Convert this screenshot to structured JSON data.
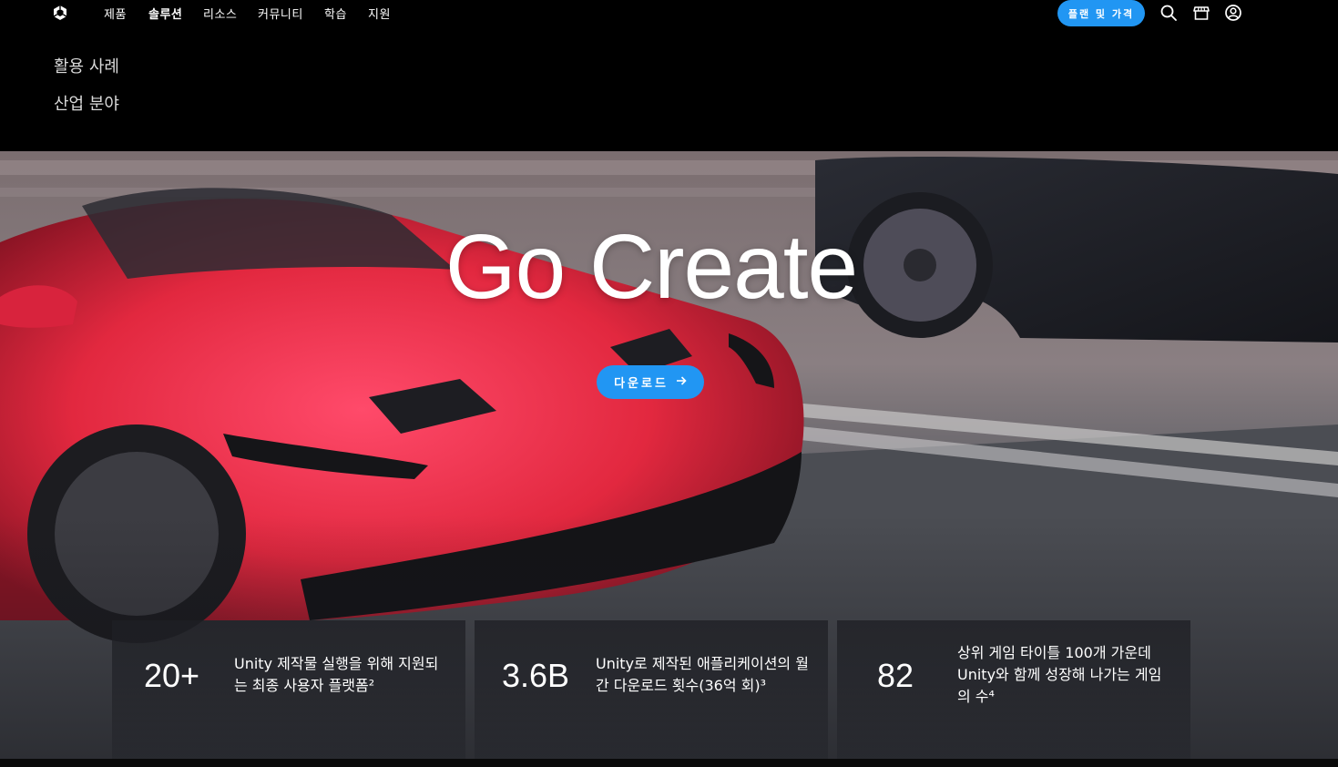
{
  "nav": {
    "items": [
      "제품",
      "솔루션",
      "리소스",
      "커뮤니티",
      "학습",
      "지원"
    ],
    "active_index": 1,
    "plan_button": "플랜 및 가격",
    "icons": [
      "unity-logo-icon",
      "search-icon",
      "store-icon",
      "account-icon"
    ]
  },
  "submenu": {
    "items": [
      "활용 사례",
      "산업 분야"
    ]
  },
  "hero": {
    "title": "Go Create",
    "download_button": "다운로드"
  },
  "stats": [
    {
      "value": "20+",
      "description": "Unity 제작물 실행을 위해 지원되는 최종 사용자 플랫폼²"
    },
    {
      "value": "3.6B",
      "description": "Unity로 제작된 애플리케이션의 월간 다운로드 횟수(36억 회)³"
    },
    {
      "value": "82",
      "description": "상위 게임 타이틀 100개 가운데 Unity와 함께 성장해 나가는 게임의 수⁴"
    }
  ],
  "colors": {
    "accent": "#2196f3",
    "background": "#000000"
  }
}
